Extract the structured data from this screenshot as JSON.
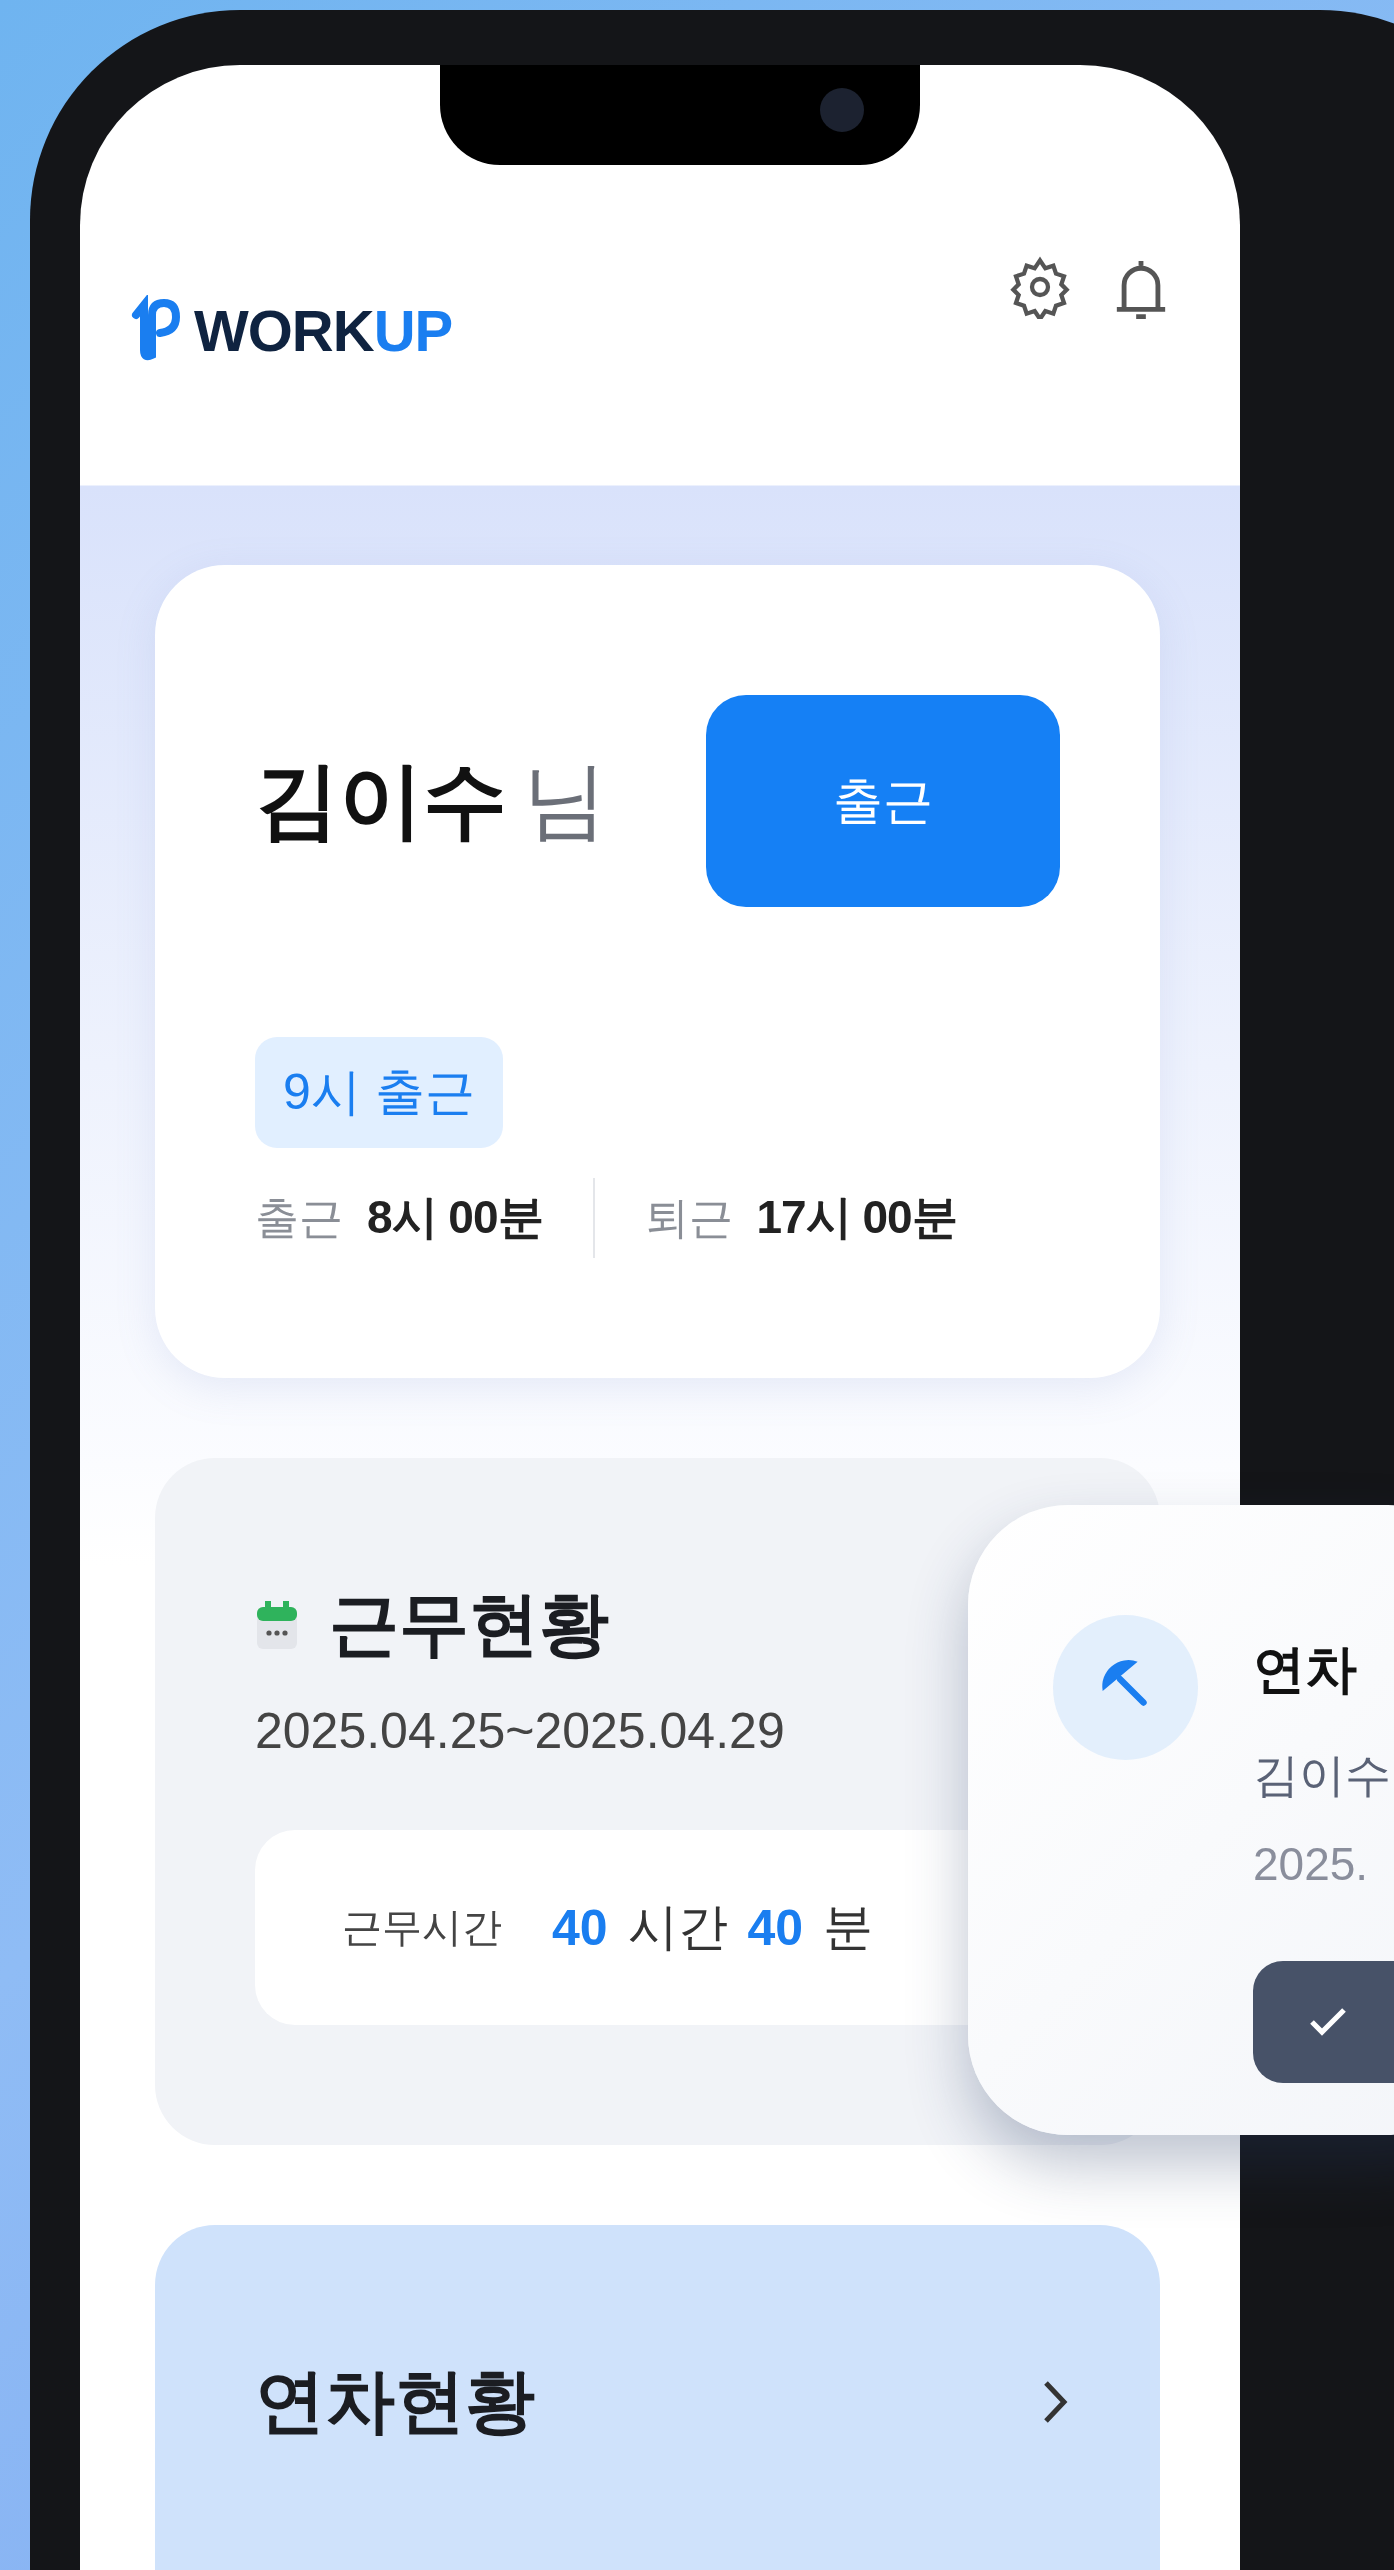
{
  "app": {
    "logo_prefix": "WORK",
    "logo_accent": "UP"
  },
  "attendance": {
    "name": "김이수",
    "honorific": "님",
    "clock_in_button": "출근",
    "shift_tag": "9시 출근",
    "times": [
      {
        "label": "출근",
        "value": "8시 00분"
      },
      {
        "label": "퇴근",
        "value": "17시 00분"
      }
    ]
  },
  "work_status": {
    "title": "근무현황",
    "period": "2025.04.25~2025.04.29",
    "summary_label": "근무시간",
    "hours": "40",
    "hours_unit": "시간",
    "minutes": "40",
    "minutes_unit": "분"
  },
  "leave_status": {
    "title": "연차현황"
  },
  "popup": {
    "title": "연차",
    "name": "김이수",
    "date": "2025."
  }
}
